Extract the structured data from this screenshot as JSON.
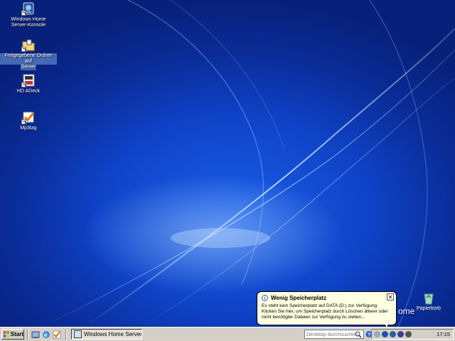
{
  "desktop": {
    "icons": [
      {
        "label_line1": "Windows Home",
        "label_line2": "Server-Konsole",
        "icon": "whs-console-icon"
      },
      {
        "label_line1": "Freigegebene Ordner auf",
        "label_line2": "Server",
        "icon": "shared-folder-icon"
      },
      {
        "label_line1": "HD ADeck",
        "label_line2": "",
        "icon": "hd-adeck-icon"
      },
      {
        "label_line1": "Mp3tag",
        "label_line2": "",
        "icon": "mp3tag-icon"
      }
    ],
    "wallpaper_text": "ome",
    "recycle_bin": "Papierkorb"
  },
  "balloon": {
    "title": "Wenig Speicherplatz",
    "line1": "Es steht kein Speicherplatz auf DATA (D:) zur Verfügung.",
    "line2": "Klicken Sie hier, um Speicherplatz durch Löschen älterer oder",
    "line3": "nicht benötigter Dateien zur Verfügung zu stellen...",
    "close_label": "✕"
  },
  "taskbar": {
    "start_label": "Start",
    "quick_launch": [
      "show-desktop-icon",
      "internet-explorer-icon",
      "mp3tag-icon"
    ],
    "task_button": "Windows Home Server-D...",
    "search_placeholder": "Desktop durchsuchen",
    "clock": "17:15"
  },
  "colors": {
    "desktop_blue": "#0f43c8",
    "taskbar": "#d4d0c8",
    "balloon_bg": "#ffffe1"
  }
}
